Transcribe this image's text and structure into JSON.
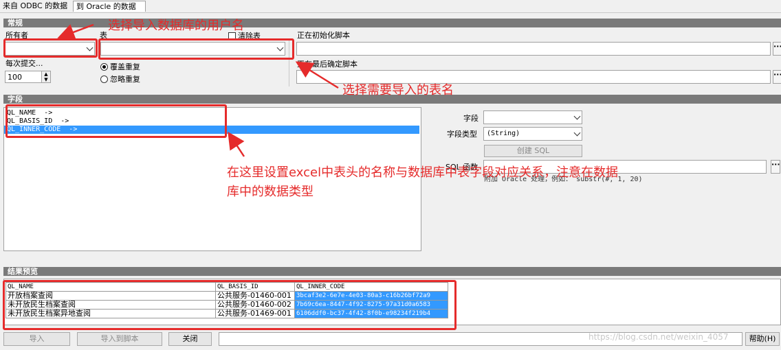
{
  "tabs": [
    "来自 ODBC 的数据",
    "到 Oracle 的数据"
  ],
  "sections": {
    "general": "常规",
    "fields": "字段",
    "preview": "结果预览"
  },
  "general": {
    "owner_label": "所有者",
    "table_label": "表",
    "clear_table_label": "清除表",
    "commit_label": "每次提交...",
    "commit_value": "100",
    "overwrite_label": "覆盖重复",
    "ignore_label": "忽略重复",
    "init_script_label": "正在初始化脚本",
    "final_script_label": "正在最后确定脚本"
  },
  "fields": {
    "mappings": [
      "QL_NAME  ->",
      "QL_BASIS_ID  ->",
      "QL_INNER_CODE  ->"
    ],
    "field_label": "字段",
    "field_type_label": "字段类型",
    "field_type_value": "(String)",
    "create_sql_button": "创建 SQL",
    "sql_function_label": "SQL 函数",
    "hint": "附加 Oracle 处理，例如：  substr(#, 1, 20)"
  },
  "preview": {
    "columns": [
      "QL_NAME",
      "QL_BASIS_ID",
      "QL_INNER_CODE"
    ],
    "rows": [
      [
        "开放档案查阅",
        "公共服务-01460-001",
        "3bcaf3e2-6e7e-4e03-80a3-c16b26bf72a9"
      ],
      [
        "未开放民生档案查阅",
        "公共服务-01460-002",
        "7b69c6ea-8447-4f92-8275-97a31d0a6583"
      ],
      [
        "未开放民生档案异地查阅",
        "公共服务-01469-001",
        "6106ddf0-bc37-4f42-8f0b-e98234f219b4"
      ]
    ]
  },
  "bottom": {
    "import_button": "导入",
    "import_script_button": "导入到脚本",
    "close_button": "关闭",
    "help_button": "帮助(H)",
    "watermark": "https://blog.csdn.net/weixin_4057"
  },
  "annotations": {
    "owner_note": "选择导入数据库的用户名",
    "table_note": "选择需要导入的表名",
    "mapping_note_line1": "在这里设置excel中表头的名称与数据库中表字段对应关系，注意在数据",
    "mapping_note_line2": "库中的数据类型"
  },
  "colors": {
    "section_bar": "#7a7a7a",
    "selection": "#3399ff",
    "annotation_red": "#e52b2b"
  },
  "icons": [
    "chevron-down-icon",
    "ellipsis-icon",
    "spinner-up-icon",
    "spinner-down-icon",
    "arrow-annotation-icon"
  ]
}
